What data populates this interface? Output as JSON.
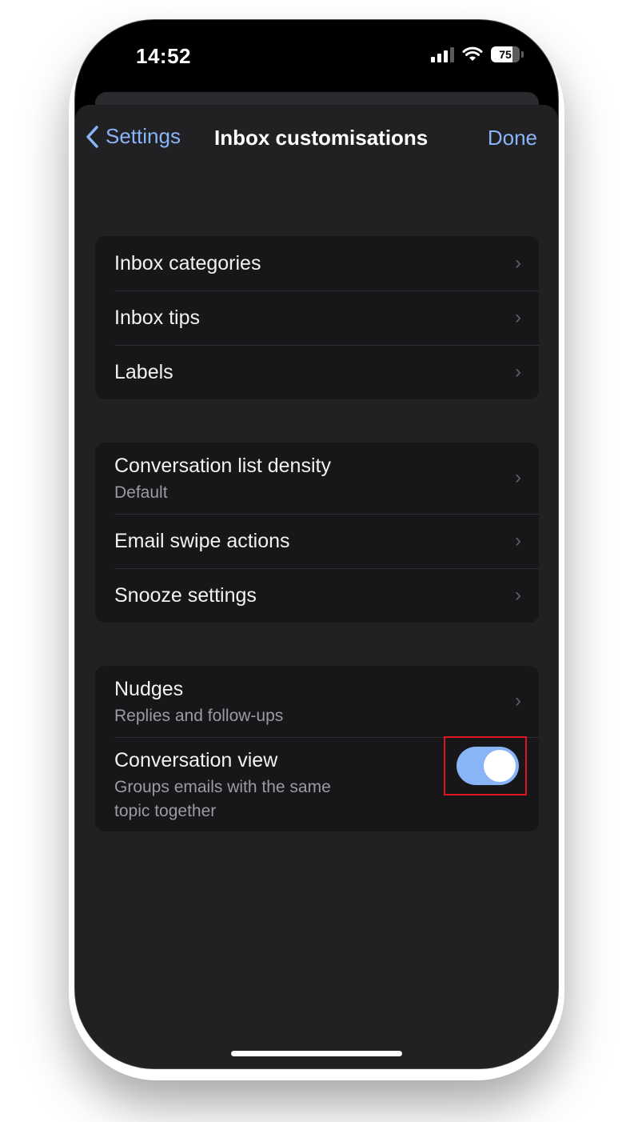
{
  "status": {
    "time": "14:52",
    "battery": "75"
  },
  "nav": {
    "back_label": "Settings",
    "title": "Inbox customisations",
    "done_label": "Done"
  },
  "groups": [
    {
      "rows": [
        {
          "title": "Inbox categories"
        },
        {
          "title": "Inbox tips"
        },
        {
          "title": "Labels"
        }
      ]
    },
    {
      "rows": [
        {
          "title": "Conversation list density",
          "subtitle": "Default"
        },
        {
          "title": "Email swipe actions"
        },
        {
          "title": "Snooze settings"
        }
      ]
    },
    {
      "rows": [
        {
          "title": "Nudges",
          "subtitle": "Replies and follow-ups"
        },
        {
          "title": "Conversation view",
          "subtitle_line1": "Groups emails with the same",
          "subtitle_line2": "topic together",
          "toggle_on": true
        }
      ]
    }
  ],
  "colors": {
    "accent": "#8ab4f8",
    "highlight_border": "#e0141e",
    "sheet_bg": "#212124",
    "group_bg": "#171719"
  },
  "icons": {
    "chevron": "chevron-right-icon",
    "back": "chevron-left-icon"
  }
}
